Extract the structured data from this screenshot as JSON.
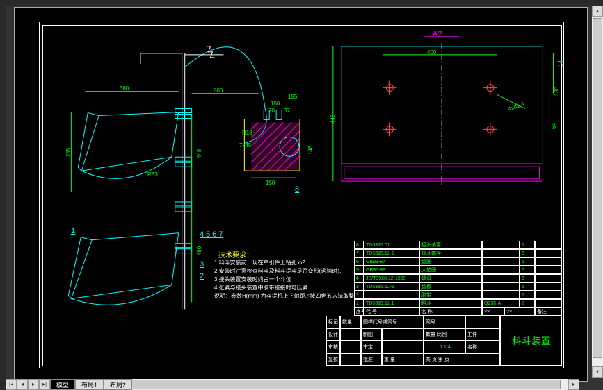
{
  "domain": "Diagram",
  "cad": {
    "section_marker": "A?",
    "dimensions": {
      "d380": "380",
      "d800": "800",
      "d255": "255",
      "dR83": "R83",
      "d448_left": "448",
      "d480": "480",
      "d150a": "150",
      "d195": "195",
      "d70": "70",
      "d37": "37",
      "d148": "148",
      "d150b": "150",
      "dR18": "R18",
      "d7x45": "7x45",
      "d400": "400",
      "d448_right": "448",
      "d4xd14": "4xd1.4",
      "d180": "180",
      "d64": "64",
      "d14": "14"
    },
    "leaders": {
      "g1": "1",
      "g4567": "4 5 6 7",
      "g3": "3",
      "g2": "2",
      "g8": "8"
    },
    "notes_title": "技术要求：",
    "notes": {
      "n1": "1.料斗安装前，现在牵引件上钻孔 φ2",
      "n2": "2.安装时注意检查料斗及料斗提斗是否变形(运输时).",
      "n3": "3.接头装置安装时约占一个斗位",
      "n4": "4.张紧与接头装置中胶带接接时可压紧.",
      "n5": "说明：参数H(mm) 为斗提机上下轴距.n按四舍五入法取整."
    },
    "bom": {
      "r8": {
        "no": "8",
        "code": "TD6315.07",
        "name": "接头装置",
        "qty": "1"
      },
      "r7": {
        "no": "7",
        "code": "TD6315.12-2",
        "name": "提斗螺栓",
        "qty": "6"
      },
      "r6": {
        "no": "6",
        "code": "GB93-87",
        "name": "垫圈",
        "qty": "6"
      },
      "r5": {
        "no": "5",
        "code": "GB96-88",
        "name": "大垫圈",
        "qty": "6"
      },
      "r4": {
        "no": "4",
        "code": "JB/T3928.12-1999",
        "name": "螺母",
        "qty": "6"
      },
      "r3": {
        "no": "3",
        "code": "TD6315.12-1",
        "name": "垫板",
        "qty": "1"
      },
      "r2": {
        "no": "2",
        "code": "",
        "name": "胶带",
        "mat": "",
        "qty": "1"
      },
      "r1": {
        "no": "1",
        "code": "TD6315.12.1",
        "name": "料斗",
        "mat": "Q235-A",
        "qty": "2"
      },
      "hdr": {
        "c1": "序号",
        "c2": "代 号",
        "c3": "名    称",
        "c4": "??",
        "c5": "??",
        "c6": "备注"
      }
    },
    "titleblock": {
      "title": "料斗装置",
      "fields": {
        "f1": "标记",
        "f2": "数量",
        "f3": "图样代号或简号",
        "f4": "简号",
        "f5": "设计",
        "f6": "制图",
        "f7": "数量  比例",
        "f8": "工件",
        "f9": "审核",
        "f10": "审定",
        "f11": "1    1:4",
        "f12": "名称",
        "f13": "复核",
        "f14": "批准",
        "f15": "重 量",
        "f16": "共 页   第 页"
      }
    }
  },
  "ui": {
    "tab_model": "模型",
    "tab_layout1": "布局1",
    "tab_layout2": "布局2"
  }
}
